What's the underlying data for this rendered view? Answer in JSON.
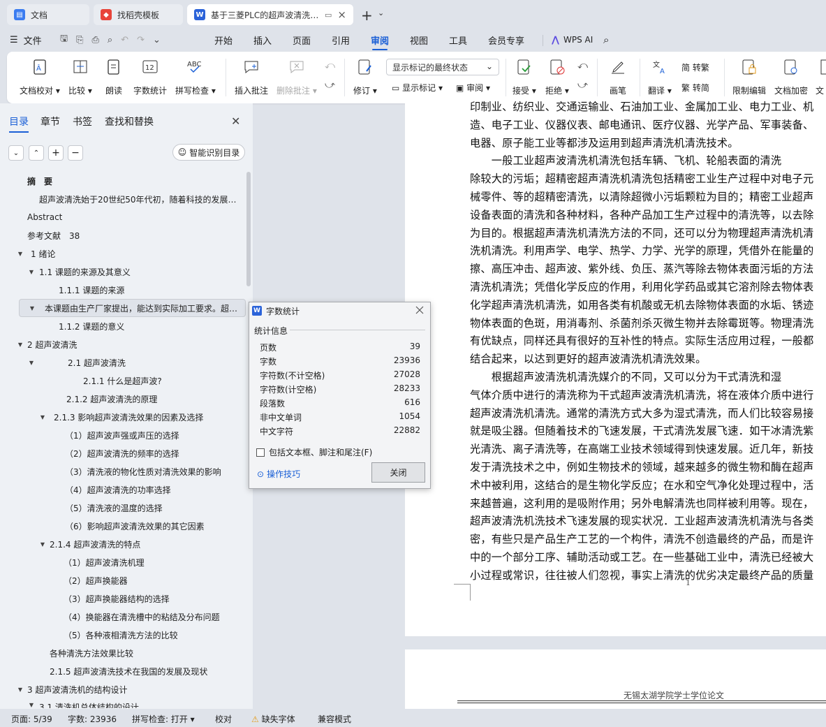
{
  "tabs": [
    {
      "label": "文档",
      "icon": "docs-icon",
      "color": "#3b7cf0"
    },
    {
      "label": "找稻壳模板",
      "icon": "docer-icon",
      "color": "#e8443a"
    },
    {
      "label": "基于三菱PLC的超声波清洗机设计",
      "icon": "wps-writer-icon",
      "color": "#2b63d9"
    }
  ],
  "menu": {
    "file": "文件",
    "items": [
      "开始",
      "插入",
      "页面",
      "引用",
      "审阅",
      "视图",
      "工具",
      "会员专享"
    ],
    "active": "审阅",
    "ai": "WPS AI"
  },
  "ribbon": {
    "doc_check": "文档校对",
    "compare": "比较",
    "read_aloud": "朗读",
    "word_count": "字数统计",
    "spell_check": "拼写检查",
    "insert_comment": "插入批注",
    "delete_comment": "删除批注",
    "revise": "修订",
    "markup_select": "显示标记的最终状态",
    "show_markup": "显示标记",
    "review": "审阅",
    "accept": "接受",
    "reject": "拒绝",
    "brush": "画笔",
    "translate": "翻译",
    "to_trad": "转繁",
    "to_simp": "转简",
    "restrict_edit": "限制编辑",
    "doc_encrypt": "文档加密",
    "more": "文"
  },
  "sidebar": {
    "tabs": [
      "目录",
      "章节",
      "书签",
      "查找和替换"
    ],
    "ai_button": "智能识别目录",
    "toc": [
      {
        "text": "摘　要",
        "indent": 0
      },
      {
        "text": "超声波清洗始于20世纪50年代初，随着科技的发展…",
        "indent": 1
      },
      {
        "text": "Abstract",
        "indent": 0
      },
      {
        "text": "参考文献　38",
        "indent": 0
      },
      {
        "text": "1  绪论",
        "indent": 0
      },
      {
        "text": "1.1  课题的来源及其意义",
        "indent": 1
      },
      {
        "text": "1.1.1  课题的来源",
        "indent": 2
      },
      {
        "text": "本课题由生产厂家提出，能达到实际加工要求。超声…",
        "indent": 1
      },
      {
        "text": "1.1.2  课题的意义",
        "indent": 2
      },
      {
        "text": "2  超声波清洗",
        "indent": 0
      },
      {
        "text": "2.1  超声波清洗",
        "indent": 1
      },
      {
        "text": "2.1.1  什么是超声波?",
        "indent": 2
      },
      {
        "text": "2.1.2  超声波清洗的原理",
        "indent": 2
      },
      {
        "text": "2.1.3  影响超声波清洗效果的因素及选择",
        "indent": 1
      },
      {
        "text": "（1）超声波声强或声压的选择",
        "indent": 2
      },
      {
        "text": "（2）超声波清洗的频率的选择",
        "indent": 2
      },
      {
        "text": "（3）清洗液的物化性质对清洗效果的影响",
        "indent": 2
      },
      {
        "text": "（4）超声波清洗的功率选择",
        "indent": 2
      },
      {
        "text": "（5）清洗液的温度的选择",
        "indent": 2
      },
      {
        "text": "（6）影响超声波清洗效果的其它因素",
        "indent": 2
      },
      {
        "text": "2.1.4  超声波清洗的特点",
        "indent": 1
      },
      {
        "text": "（1）超声波清洗机理",
        "indent": 2
      },
      {
        "text": "（2）超声换能器",
        "indent": 2
      },
      {
        "text": "（3）超声换能器结构的选择",
        "indent": 2
      },
      {
        "text": "（4）换能器在清洗槽中的粘结及分布问题",
        "indent": 2
      },
      {
        "text": "（5）各种液相清洗方法的比较",
        "indent": 2
      },
      {
        "text": "各种清洗方法效果比较",
        "indent": 1
      },
      {
        "text": "2.1.5  超声波清洗技术在我国的发展及现状",
        "indent": 1
      },
      {
        "text": "3  超声波清洗机的结构设计",
        "indent": 0
      },
      {
        "text": "3.1  清洗机总体结构的设计",
        "indent": 1
      }
    ]
  },
  "document": {
    "lines": [
      "印制业、纺织业、交通运输业、石油加工业、金属加工业、电力工业、机",
      "造、电子工业、仪器仪表、邮电通讯、医疗仪器、光学产品、军事装备、",
      "电器、原子能工业等都涉及运用到超声清洗机清洗技术。",
      "　　一般工业超声波清洗机清洗包括车辆、飞机、轮船表面的清洗",
      "除较大的污垢；超精密超声清洗机清洗包括精密工业生产过程中对电子元",
      "械零件、等的超精密清洗，以清除超微小污垢颗粒为目的；精密工业超声",
      "设备表面的清洗和各种材料，各种产品加工生产过程中的清洗等，以去除",
      "为目的。根据超声清洗机清洗方法的不同，还可以分为物理超声清洗机清",
      "洗机清洗。利用声学、电学、热学、力学、光学的原理，凭借外在能量的",
      "擦、高压冲击、超声波、紫外线、负压、蒸汽等除去物体表面污垢的方法",
      "清洗机清洗；凭借化学反应的作用，利用化学药品或其它溶剂除去物体表",
      "化学超声清洗机清洗，如用各类有机酸或无机去除物体表面的水垢、锈迹",
      "物体表面的色斑，用消毒剂、杀菌剂杀灭微生物并去除霉斑等。物理清洗",
      "有优缺点，同样还具有很好的互补性的特点。实际生活应用过程，一般都",
      "结合起来，以达到更好的超声波清洗机清洗效果。",
      "　　根据超声波清洗机清洗媒介的不同，又可以分为干式清洗和湿",
      "气体介质中进行的清洗称为干式超声波清洗机清洗，将在液体介质中进行",
      "超声波清洗机清洗。通常的清洗方式大多为湿式清洗，而人们比较容易接",
      "就是吸尘器。但随着技术的飞速发展，干式清洗发展飞速．如干冰清洗紫",
      "光清洗、离子清洗等，在高端工业技术领域得到快速发展。近几年，新技",
      "发于清洗技术之中，例如生物技术的领域，越来越多的微生物和酶在超声",
      "术中被利用，这结合的是生物化学反应；在水和空气净化处理过程中，活",
      "来越普遍，这利用的是吸附作用；另外电解清洗也同样被利用等。现在，",
      "超声波清洗机洗技术飞速发展的现实状况．工业超声波清洗机清洗与各类",
      "密，有些只是产品生产工艺的一个构件，清洗不创造最终的产品，而是许",
      "中的一个部分工序、辅助活动或工艺。在一些基础工业中，清洗已经被大",
      "小过程或常识，往往被人们忽视，事实上清洗的优劣决定最终产品的质量"
    ],
    "page_number": "1",
    "next_header": "无锡太湖学院学士学位论文"
  },
  "dialog": {
    "title": "字数统计",
    "group": "统计信息",
    "stats": [
      {
        "label": "页数",
        "value": "39"
      },
      {
        "label": "字数",
        "value": "23936"
      },
      {
        "label": "字符数(不计空格)",
        "value": "27028"
      },
      {
        "label": "字符数(计空格)",
        "value": "28233"
      },
      {
        "label": "段落数",
        "value": "616"
      },
      {
        "label": "非中文单词",
        "value": "1054"
      },
      {
        "label": "中文字符",
        "value": "22882"
      }
    ],
    "checkbox": "包括文本框、脚注和尾注(F)",
    "tips": "操作技巧",
    "close": "关闭"
  },
  "status": {
    "page": "页面: 5/39",
    "words": "字数: 23936",
    "spell": "拼写检查: 打开",
    "proof": "校对",
    "missing_font": "缺失字体",
    "compat": "兼容模式"
  }
}
